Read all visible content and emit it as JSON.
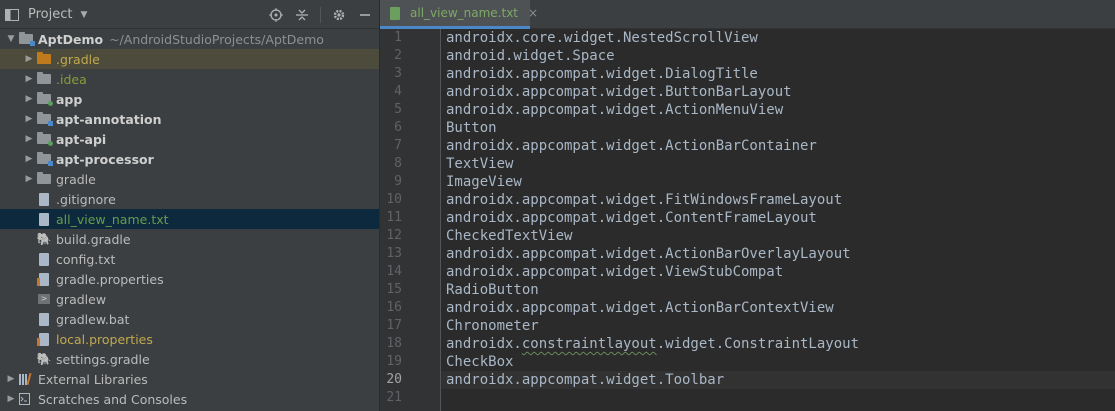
{
  "project_panel": {
    "title": "Project",
    "header_icons": [
      "target-icon",
      "collapse-all-icon",
      "gear-icon",
      "hide-panel-icon"
    ],
    "tree": [
      {
        "label": "AptDemo",
        "path": "~/AndroidStudioProjects/AptDemo",
        "expanded": true,
        "kind": "module-root"
      },
      {
        "label": ".gradle",
        "kind": "folder-orange",
        "collapsed": true
      },
      {
        "label": ".idea",
        "kind": "folder",
        "collapsed": true
      },
      {
        "label": "app",
        "kind": "module",
        "collapsed": true
      },
      {
        "label": "apt-annotation",
        "kind": "module",
        "collapsed": true
      },
      {
        "label": "apt-api",
        "kind": "module",
        "collapsed": true
      },
      {
        "label": "apt-processor",
        "kind": "module",
        "collapsed": true
      },
      {
        "label": "gradle",
        "kind": "folder",
        "collapsed": true
      },
      {
        "label": ".gitignore",
        "kind": "file"
      },
      {
        "label": "all_view_name.txt",
        "kind": "file",
        "selected": true
      },
      {
        "label": "build.gradle",
        "kind": "gradle"
      },
      {
        "label": "config.txt",
        "kind": "file"
      },
      {
        "label": "gradle.properties",
        "kind": "properties"
      },
      {
        "label": "gradlew",
        "kind": "terminal"
      },
      {
        "label": "gradlew.bat",
        "kind": "file"
      },
      {
        "label": "local.properties",
        "kind": "properties"
      },
      {
        "label": "settings.gradle",
        "kind": "gradle"
      },
      {
        "label": "External Libraries",
        "kind": "libraries",
        "collapsed": true
      },
      {
        "label": "Scratches and Consoles",
        "kind": "scratches",
        "collapsed": true
      }
    ]
  },
  "editor": {
    "tab": {
      "label": "all_view_name.txt",
      "close": "×"
    },
    "current_line": 20,
    "lines": [
      "androidx.core.widget.NestedScrollView",
      "android.widget.Space",
      "androidx.appcompat.widget.DialogTitle",
      "androidx.appcompat.widget.ButtonBarLayout",
      "androidx.appcompat.widget.ActionMenuView",
      "Button",
      "androidx.appcompat.widget.ActionBarContainer",
      "TextView",
      "ImageView",
      "androidx.appcompat.widget.FitWindowsFrameLayout",
      "androidx.appcompat.widget.ContentFrameLayout",
      "CheckedTextView",
      "androidx.appcompat.widget.ActionBarOverlayLayout",
      "androidx.appcompat.widget.ViewStubCompat",
      "RadioButton",
      "androidx.appcompat.widget.ActionBarContextView",
      "Chronometer",
      "androidx.constraintlayout.widget.ConstraintLayout",
      "CheckBox",
      "androidx.appcompat.widget.Toolbar",
      ""
    ],
    "line_numbers": [
      "1",
      "2",
      "3",
      "4",
      "5",
      "6",
      "7",
      "8",
      "9",
      "10",
      "11",
      "12",
      "13",
      "14",
      "15",
      "16",
      "17",
      "18",
      "19",
      "20",
      "21"
    ]
  }
}
